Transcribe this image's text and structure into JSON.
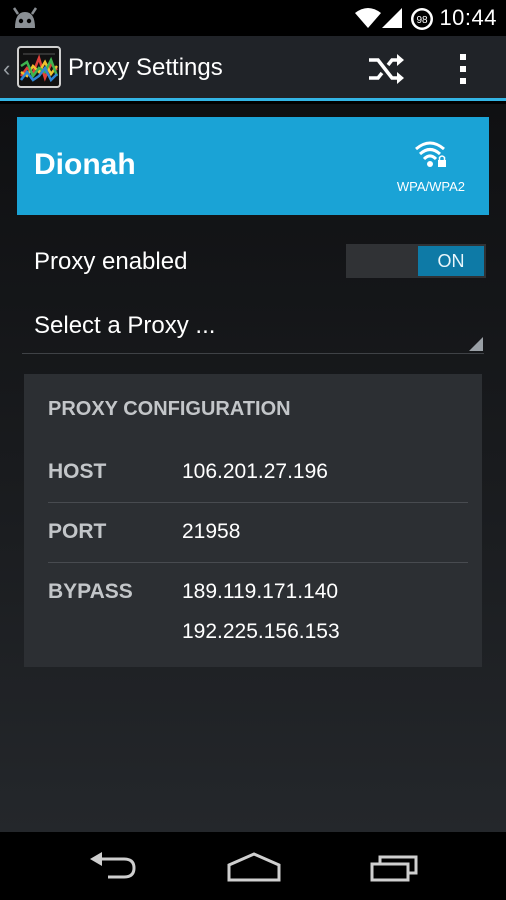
{
  "status_bar": {
    "time": "10:44",
    "battery_level": "98",
    "icons": [
      "cyanogenmod-logo-icon",
      "wifi-signal-icon",
      "cell-signal-icon",
      "battery-icon"
    ]
  },
  "action_bar": {
    "title": "Proxy Settings",
    "icons": [
      "app-icon",
      "shuffle-icon",
      "overflow-menu-icon"
    ]
  },
  "wifi": {
    "ssid": "Dionah",
    "security": "WPA/WPA2"
  },
  "proxy": {
    "enabled_label": "Proxy enabled",
    "toggle_state": "ON",
    "select_label": "Select a Proxy ..."
  },
  "config": {
    "header": "PROXY CONFIGURATION",
    "host_label": "HOST",
    "host_value": "106.201.27.196",
    "port_label": "PORT",
    "port_value": "21958",
    "bypass_label": "BYPASS",
    "bypass_values": [
      "189.119.171.140",
      "192.225.156.153"
    ]
  },
  "nav_bar": {
    "icons": [
      "back-icon",
      "home-icon",
      "recents-icon"
    ]
  },
  "colors": {
    "accent": "#33b5e5",
    "wifi_card": "#1aa3d6",
    "toggle_on": "#0e7aa6",
    "action_bar": "#202328",
    "panel": "#2c2f33"
  }
}
